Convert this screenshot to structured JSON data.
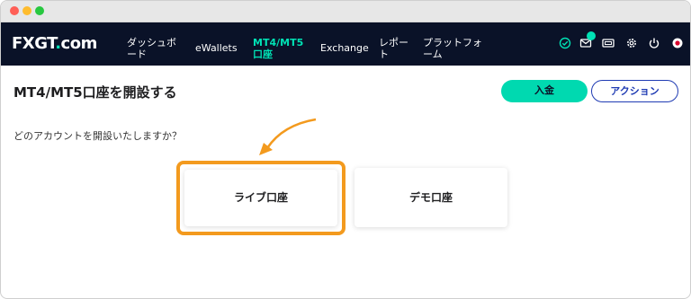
{
  "colors": {
    "navbar_bg": "#0a1228",
    "accent": "#00e2b5",
    "deposit_button": "#00d9b0",
    "action_border": "#1f3bb3",
    "highlight": "#f39a1e"
  },
  "logo": {
    "fx": "FX",
    "gt": "GT",
    "dot": ".",
    "com": "com"
  },
  "nav": {
    "dashboard": [
      "ダッシュボ",
      "ード"
    ],
    "ewallets": "eWallets",
    "mt_account": [
      "MT4/MT5",
      "口座"
    ],
    "exchange": "Exchange",
    "report": [
      "レポー",
      "ト"
    ],
    "platform": [
      "プラットフォ",
      "ーム"
    ]
  },
  "nav_icons": [
    "verified-check-icon",
    "mail-icon",
    "ticket-icon",
    "gear-icon",
    "power-icon",
    "flag-icon"
  ],
  "page": {
    "title": "MT4/MT5口座を開設する",
    "question": "どのアカウントを開設いたしますか？"
  },
  "buttons": {
    "deposit": "入金",
    "action": "アクション"
  },
  "account_types": [
    {
      "label": "ライブ口座",
      "highlighted": true
    },
    {
      "label": "デモ口座",
      "highlighted": false
    }
  ]
}
